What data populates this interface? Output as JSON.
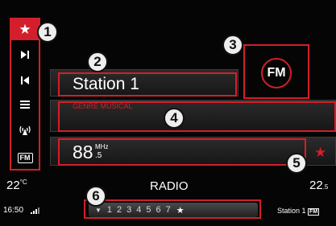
{
  "sidebar": {
    "favorites_icon": "star-icon",
    "items": [
      {
        "icon": "next-track-icon"
      },
      {
        "icon": "previous-track-icon"
      },
      {
        "icon": "list-icon"
      },
      {
        "icon": "antenna-icon"
      },
      {
        "icon": "fm-band-icon",
        "label": "FM"
      }
    ]
  },
  "station": {
    "name": "Station 1",
    "genre": "GENRE MUSICAL",
    "frequency_main": "88",
    "frequency_decimal": ".5",
    "frequency_unit": "MHz"
  },
  "band": {
    "label": "FM"
  },
  "status_bar": {
    "temp_left": "22",
    "temp_left_unit": "°C",
    "title": "RADIO",
    "temp_right": "22",
    "temp_right_decimal": ".5",
    "time": "16:50",
    "station_right": "Station 1",
    "station_right_badge": "FM"
  },
  "presets": {
    "items": [
      "1",
      "2",
      "3",
      "4",
      "5",
      "6",
      "7"
    ]
  },
  "callouts": [
    "1",
    "2",
    "3",
    "4",
    "5",
    "6"
  ],
  "colors": {
    "accent_red": "#d21f2b",
    "background": "#050505"
  }
}
